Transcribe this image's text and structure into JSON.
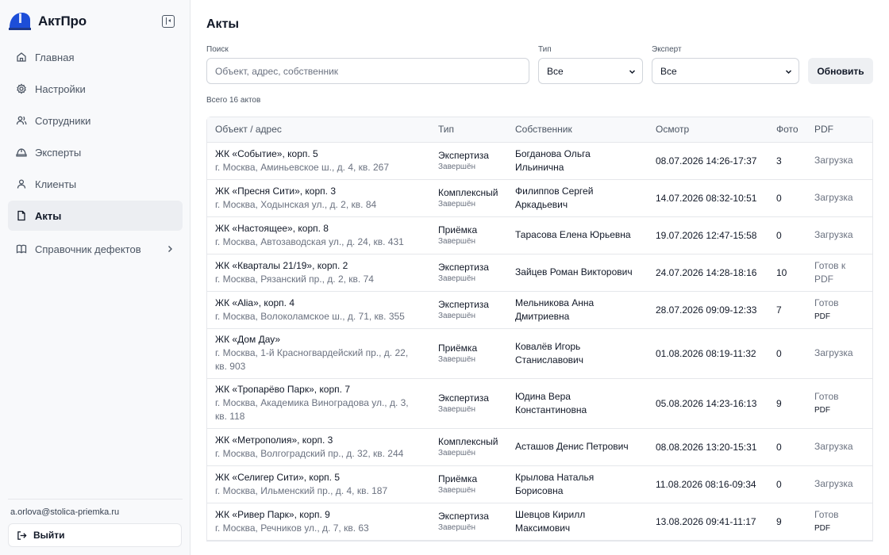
{
  "app": {
    "name": "АктПро"
  },
  "sidebar": {
    "items": [
      {
        "label": "Главная",
        "icon": "home-icon"
      },
      {
        "label": "Настройки",
        "icon": "gear-icon"
      },
      {
        "label": "Сотрудники",
        "icon": "users-icon"
      },
      {
        "label": "Эксперты",
        "icon": "helmet-icon"
      },
      {
        "label": "Клиенты",
        "icon": "user-icon"
      },
      {
        "label": "Акты",
        "icon": "document-icon",
        "active": true
      },
      {
        "label": "Справочник дефектов",
        "icon": "book-icon"
      }
    ],
    "user_email": "a.orlova@stolica-priemka.ru",
    "logout_label": "Выйти"
  },
  "page": {
    "title": "Акты",
    "search_label": "Поиск",
    "search_placeholder": "Объект, адрес, собственник",
    "type_label": "Тип",
    "type_value": "Все",
    "expert_label": "Эксперт",
    "expert_value": "Все",
    "refresh_label": "Обновить",
    "total": "Всего 16 актов"
  },
  "table": {
    "headers": [
      "Объект / адрес",
      "Тип",
      "Собственник",
      "Осмотр",
      "Фото",
      "PDF"
    ],
    "rows": [
      {
        "object": "ЖК «Событие», корп. 5",
        "address": "г. Москва, Аминьевское ш., д. 4, кв. 267",
        "type": "Экспертиза",
        "status": "Завершён",
        "owner": "Богданова Ольга Ильинична",
        "inspection": "08.07.2026 14:26-17:37",
        "photos": "3",
        "pdf": "Загрузка",
        "pdf_sub": ""
      },
      {
        "object": "ЖК «Пресня Сити», корп. 3",
        "address": "г. Москва, Ходынская ул., д. 2, кв. 84",
        "type": "Комплексный",
        "status": "Завершён",
        "owner": "Филиппов Сергей Аркадьевич",
        "inspection": "14.07.2026 08:32-10:51",
        "photos": "0",
        "pdf": "Загрузка",
        "pdf_sub": ""
      },
      {
        "object": "ЖК «Настоящее», корп. 8",
        "address": "г. Москва, Автозаводская ул., д. 24, кв. 431",
        "type": "Приёмка",
        "status": "Завершён",
        "owner": "Тарасова Елена Юрьевна",
        "inspection": "19.07.2026 12:47-15:58",
        "photos": "0",
        "pdf": "Загрузка",
        "pdf_sub": ""
      },
      {
        "object": "ЖК «Кварталы 21/19», корп. 2",
        "address": "г. Москва, Рязанский пр., д. 2, кв. 74",
        "type": "Экспертиза",
        "status": "Завершён",
        "owner": "Зайцев Роман Викторович",
        "inspection": "24.07.2026 14:28-18:16",
        "photos": "10",
        "pdf": "Готов к PDF",
        "pdf_sub": ""
      },
      {
        "object": "ЖК «Alia», корп. 4",
        "address": "г. Москва, Волоколамское ш., д. 71, кв. 355",
        "type": "Экспертиза",
        "status": "Завершён",
        "owner": "Мельникова Анна Дмитриевна",
        "inspection": "28.07.2026 09:09-12:33",
        "photos": "7",
        "pdf": "Готов",
        "pdf_sub": "PDF"
      },
      {
        "object": "ЖК «Дом Дау»",
        "address": "г. Москва, 1-й Красногвардейский пр., д. 22, кв. 903",
        "type": "Приёмка",
        "status": "Завершён",
        "owner": "Ковалёв Игорь Станиславович",
        "inspection": "01.08.2026 08:19-11:32",
        "photos": "0",
        "pdf": "Загрузка",
        "pdf_sub": ""
      },
      {
        "object": "ЖК «Тропарёво Парк», корп. 7",
        "address": "г. Москва, Академика Виноградова ул., д. 3, кв. 118",
        "type": "Экспертиза",
        "status": "Завершён",
        "owner": "Юдина Вера Константиновна",
        "inspection": "05.08.2026 14:23-16:13",
        "photos": "9",
        "pdf": "Готов",
        "pdf_sub": "PDF"
      },
      {
        "object": "ЖК «Метрополия», корп. 3",
        "address": "г. Москва, Волгоградский пр., д. 32, кв. 244",
        "type": "Комплексный",
        "status": "Завершён",
        "owner": "Асташов Денис Петрович",
        "inspection": "08.08.2026 13:20-15:31",
        "photos": "0",
        "pdf": "Загрузка",
        "pdf_sub": ""
      },
      {
        "object": "ЖК «Селигер Сити», корп. 5",
        "address": "г. Москва, Ильменский пр., д. 4, кв. 187",
        "type": "Приёмка",
        "status": "Завершён",
        "owner": "Крылова Наталья Борисовна",
        "inspection": "11.08.2026 08:16-09:34",
        "photos": "0",
        "pdf": "Загрузка",
        "pdf_sub": ""
      },
      {
        "object": "ЖК «Ривер Парк», корп. 9",
        "address": "г. Москва, Речников ул., д. 7, кв. 63",
        "type": "Экспертиза",
        "status": "Завершён",
        "owner": "Шевцов Кирилл Максимович",
        "inspection": "13.08.2026 09:41-11:17",
        "photos": "9",
        "pdf": "Готов",
        "pdf_sub": "PDF"
      }
    ]
  },
  "colors": {
    "sidebar_bg": "#f8f9fb",
    "active_bg": "#eceef2",
    "brand_blue": "#1d4ed8",
    "muted_text": "#6b7280"
  }
}
